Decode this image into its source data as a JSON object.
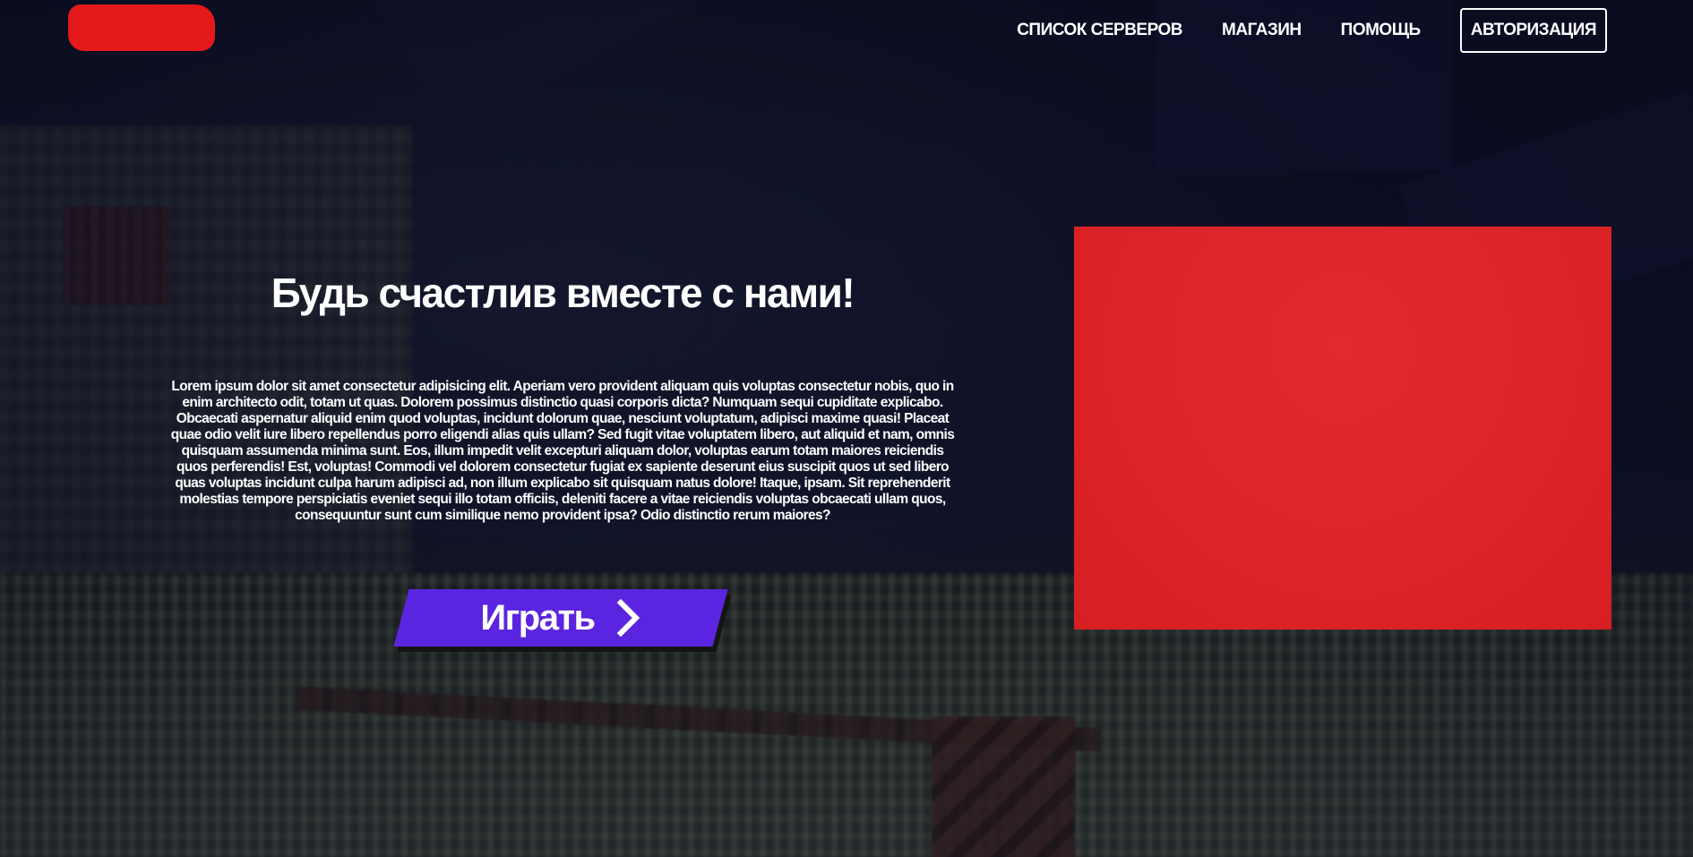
{
  "header": {
    "nav": [
      {
        "label": "СПИСОК СЕРВЕРОВ"
      },
      {
        "label": "МАГАЗИН"
      },
      {
        "label": "ПОМОЩЬ"
      }
    ],
    "auth_label": "АВТОРИЗАЦИЯ",
    "logo_color": "#e5191c"
  },
  "hero": {
    "title": "Будь счастлив вместе с нами!",
    "text": "Lorem ipsum dolor sit amet consectetur adipisicing elit. Aperiam vero provident aliquam quis voluptas consectetur nobis, quo in enim architecto odit, totam ut quas. Dolorem possimus distinctio quasi corporis dicta? Numquam sequi cupiditate explicabo. Obcaecati aspernatur aliquid enim quod voluptas, incidunt dolorum quae, nesciunt voluptatum, adipisci maxime quasi! Placeat quae odio velit iure libero repellendus porro eligendi alias quis ullam? Sed fugit vitae voluptatem libero, aut aliquid et nam, omnis quisquam assumenda minima sunt. Eos, illum impedit velit excepturi aliquam dolor, voluptas earum totam maiores reiciendis quos perferendis! Est, voluptas! Commodi vel dolorem consectetur fugiat ex sapiente deserunt eius suscipit quos ut sed libero quas voluptas incidunt culpa harum adipisci ad, non illum explicabo sit quisquam natus dolore! Itaque, ipsam. Sit reprehenderit molestias tempore perspiciatis eveniet sequi illo totam officiis, deleniti facere a vitae reiciendis voluptas obcaecati ullam quos, consequuntur sunt cum similique nemo provident ipsa? Odio distinctio rerum maiores?",
    "play_label": "Играть",
    "play_icon": "chevron-right-icon",
    "play_color": "#5b24e0"
  },
  "media": {
    "color": "#dc2327"
  }
}
